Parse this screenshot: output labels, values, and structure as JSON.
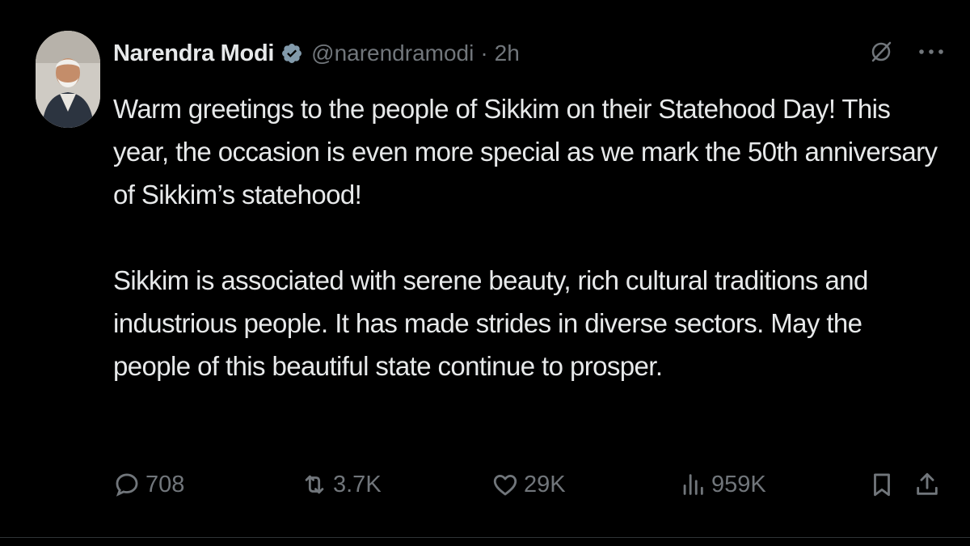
{
  "author": {
    "name": "Narendra Modi",
    "handle": "@narendramodi",
    "separator": "·",
    "time": "2h"
  },
  "tweet": {
    "paragraph1": "Warm greetings to the people of Sikkim on their Statehood Day! This year, the occasion is even more special as we mark the 50th anniversary of Sikkim’s statehood!",
    "paragraph2": "Sikkim is associated with serene beauty, rich cultural traditions and industrious people. It has made strides in diverse sectors. May the people of this beautiful state continue to prosper."
  },
  "stats": {
    "replies": "708",
    "reposts": "3.7K",
    "likes": "29K",
    "views": "959K"
  },
  "icons": {
    "verified": "verified-badge-icon",
    "grok": "grok-icon",
    "more": "more-icon",
    "reply": "reply-icon",
    "repost": "repost-icon",
    "like": "heart-icon",
    "views": "views-icon",
    "bookmark": "bookmark-icon",
    "share": "share-icon"
  },
  "colors": {
    "background": "#000000",
    "text": "#e7e9ea",
    "muted": "#71767b"
  }
}
